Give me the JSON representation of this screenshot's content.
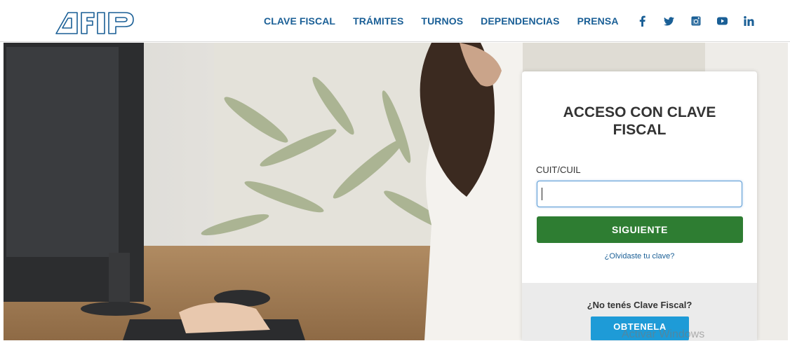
{
  "header": {
    "logo_text": "AFIP",
    "nav": [
      "CLAVE FISCAL",
      "TRÁMITES",
      "TURNOS",
      "DEPENDENCIAS",
      "PRENSA"
    ],
    "social": [
      "facebook-icon",
      "twitter-icon",
      "instagram-icon",
      "youtube-icon",
      "linkedin-icon"
    ],
    "link_color": "#1a5f96"
  },
  "login": {
    "title": "ACCESO CON CLAVE FISCAL",
    "field_label": "CUIT/CUIL",
    "field_value": "",
    "submit_label": "SIGUIENTE",
    "submit_color": "#2e7d32",
    "forgot_label": "¿Olvidaste tu clave?",
    "no_key_text": "¿No tenés Clave Fiscal?",
    "get_label": "OBTENELA",
    "get_color": "#1e9bd7"
  },
  "watermark": "Activar Windows"
}
